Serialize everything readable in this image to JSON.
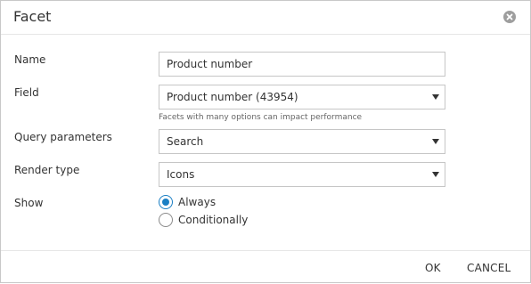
{
  "dialog": {
    "title": "Facet",
    "close_icon": "close-icon"
  },
  "form": {
    "name": {
      "label": "Name",
      "value": "Product number"
    },
    "field": {
      "label": "Field",
      "selected": "Product number (43954)",
      "hint": "Facets with many options can impact performance"
    },
    "query_parameters": {
      "label": "Query parameters",
      "selected": "Search"
    },
    "render_type": {
      "label": "Render type",
      "selected": "Icons"
    },
    "show": {
      "label": "Show",
      "options": [
        {
          "label": "Always",
          "checked": true
        },
        {
          "label": "Conditionally",
          "checked": false
        }
      ]
    }
  },
  "footer": {
    "ok_label": "OK",
    "cancel_label": "CANCEL"
  },
  "colors": {
    "accent": "#1a7fc4",
    "border": "#c6c6c6"
  }
}
